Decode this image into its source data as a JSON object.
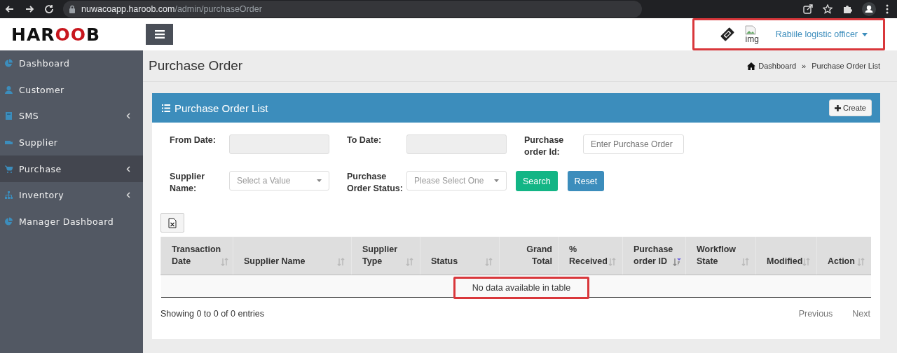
{
  "browser": {
    "url_host": "nuwacoapp.haroob.com",
    "url_path": "/admin/purchaseOrder"
  },
  "header": {
    "logo": "HAROOB",
    "user": {
      "img_alt": "img",
      "name": "Rabiile logistic officer",
      "highlighted": true
    }
  },
  "sidebar": {
    "items": [
      {
        "label": "Dashboard",
        "kind": "pie",
        "selected": false,
        "has_children": false
      },
      {
        "label": "Customer",
        "kind": "user",
        "selected": false,
        "has_children": false
      },
      {
        "label": "SMS",
        "kind": "book",
        "selected": false,
        "has_children": true
      },
      {
        "label": "Supplier",
        "kind": "truck",
        "selected": false,
        "has_children": false
      },
      {
        "label": "Purchase",
        "kind": "cart",
        "selected": true,
        "has_children": true
      },
      {
        "label": "Inventory",
        "kind": "sitemap",
        "selected": false,
        "has_children": true
      },
      {
        "label": "Manager Dashboard",
        "kind": "pie",
        "selected": false,
        "has_children": false
      }
    ]
  },
  "page": {
    "title": "Purchase Order",
    "breadcrumb": [
      "Dashboard",
      "»",
      "Purchase Order List"
    ]
  },
  "panel": {
    "title": "Purchase Order List",
    "create_button": "Create",
    "filters": [
      {
        "label": "From Date:",
        "kind": "date"
      },
      {
        "label": "To Date:",
        "kind": "date"
      },
      {
        "label": "Purchase order Id:",
        "kind": "text",
        "placeholder": "Enter Purchase Order"
      },
      {
        "label": "Supplier Name:",
        "kind": "select",
        "placeholder": "Select a Value"
      },
      {
        "label": "Purchase Order Status:",
        "kind": "select",
        "placeholder": "Please Select One"
      }
    ],
    "search_button": "Search",
    "reset_button": "Reset",
    "table": {
      "columns": [
        {
          "label": "Transaction Date",
          "sortable": true,
          "sorted": false
        },
        {
          "label": "Supplier Name",
          "sortable": true,
          "sorted": false
        },
        {
          "label": "Supplier Type",
          "sortable": true,
          "sorted": false
        },
        {
          "label": "Status",
          "sortable": true,
          "sorted": false
        },
        {
          "label": "Grand Total",
          "sortable": false,
          "sorted": false
        },
        {
          "label": "% Received",
          "sortable": true,
          "sorted": false
        },
        {
          "label": "Purchase order ID",
          "sortable": true,
          "sorted": true
        },
        {
          "label": "Workflow State",
          "sortable": true,
          "sorted": false
        },
        {
          "label": "Modified",
          "sortable": true,
          "sorted": false
        },
        {
          "label": "Action",
          "sortable": true,
          "sorted": false
        }
      ],
      "empty_message": {
        "text": "No data available in table",
        "highlighted": true
      }
    },
    "info": "Showing 0 to 0 of 0 entries",
    "pagination": [
      "Previous",
      "Next"
    ]
  }
}
